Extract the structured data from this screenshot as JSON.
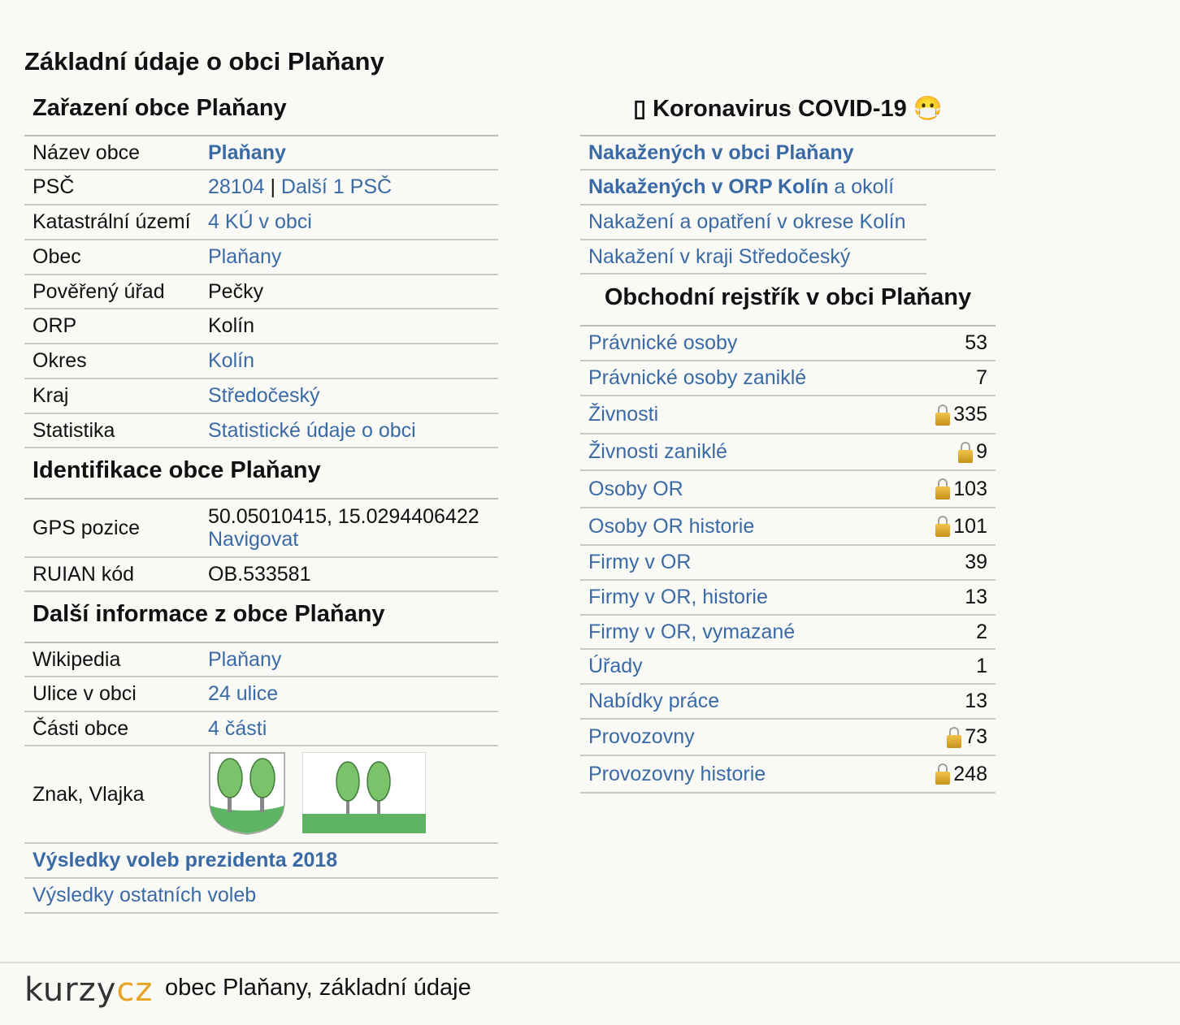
{
  "page_title": "Základní údaje o obci Plaňany",
  "classification": {
    "heading": "Zařazení obce Plaňany",
    "rows": [
      {
        "label": "Název obce",
        "value": "Plaňany"
      },
      {
        "label": "PSČ",
        "value_a": "28104",
        "sep": " | ",
        "value_b": "Další 1 PSČ"
      },
      {
        "label": "Katastrální území",
        "value": "4 KÚ v obci"
      },
      {
        "label": "Obec",
        "value": "Plaňany"
      },
      {
        "label": "Pověřený úřad",
        "value": "Pečky"
      },
      {
        "label": "ORP",
        "value": "Kolín"
      },
      {
        "label": "Okres",
        "value": "Kolín"
      },
      {
        "label": "Kraj",
        "value": "Středočeský"
      },
      {
        "label": "Statistika",
        "value": "Statistické údaje o obci"
      }
    ]
  },
  "identification": {
    "heading": "Identifikace obce Plaňany",
    "gps_label": "GPS pozice",
    "gps_value": "50.05010415, 15.0294406422",
    "gps_link": "Navigovat",
    "ruian_label": "RUIAN kód",
    "ruian_value": "OB.533581"
  },
  "more_info": {
    "heading": "Další informace z obce Plaňany",
    "rows": [
      {
        "label": "Wikipedia",
        "value": "Plaňany"
      },
      {
        "label": "Ulice v obci",
        "value": "24 ulice"
      },
      {
        "label": "Části obce",
        "value": "4 části"
      }
    ],
    "emblem_label": "Znak, Vlajka"
  },
  "elections": {
    "president": "Výsledky voleb prezidenta 2018",
    "other": "Výsledky ostatních voleb"
  },
  "covid": {
    "heading": "▯ Koronavirus COVID-19 😷",
    "links": [
      {
        "bold": "Nakažených v obci Plaňany",
        "rest": ""
      },
      {
        "bold": "Nakažených v ORP Kolín",
        "rest": " a okolí"
      },
      {
        "bold": "",
        "rest": "Nakažení a opatření v okrese Kolín"
      },
      {
        "bold": "",
        "rest": "Nakažení v kraji Středočeský"
      }
    ]
  },
  "registry": {
    "heading": "Obchodní rejstřík v obci Plaňany",
    "rows": [
      {
        "label": "Právnické osoby",
        "count": "53",
        "locked": false
      },
      {
        "label": "Právnické osoby zaniklé",
        "count": "7",
        "locked": false
      },
      {
        "label": "Živnosti",
        "count": "335",
        "locked": true
      },
      {
        "label": "Živnosti zaniklé",
        "count": "9",
        "locked": true
      },
      {
        "label": "Osoby OR",
        "count": "103",
        "locked": true
      },
      {
        "label": "Osoby OR historie",
        "count": "101",
        "locked": true
      },
      {
        "label": "Firmy v OR",
        "count": "39",
        "locked": false
      },
      {
        "label": "Firmy v OR, historie",
        "count": "13",
        "locked": false
      },
      {
        "label": "Firmy v OR, vymazané",
        "count": "2",
        "locked": false
      },
      {
        "label": "Úřady",
        "count": "1",
        "locked": false
      },
      {
        "label": "Nabídky práce",
        "count": "13",
        "locked": false
      },
      {
        "label": "Provozovny",
        "count": "73",
        "locked": true
      },
      {
        "label": "Provozovny historie",
        "count": "248",
        "locked": true
      }
    ]
  },
  "footer": {
    "logo_a": "kurzy",
    "logo_b": "cz",
    "text": "obec Plaňany, základní údaje"
  },
  "colors": {
    "link": "#3a6aa5",
    "emblem_green": "#5fb463",
    "tree_green": "#7cc26a"
  }
}
